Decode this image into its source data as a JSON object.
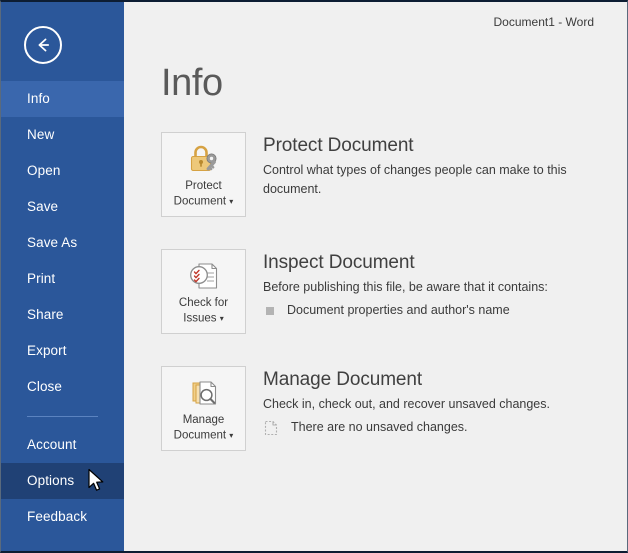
{
  "window": {
    "document_title": "Document1 - Word"
  },
  "sidebar": {
    "back_button": "back-arrow-icon",
    "items": [
      {
        "label": "Info",
        "state": "selected"
      },
      {
        "label": "New",
        "state": "normal"
      },
      {
        "label": "Open",
        "state": "normal"
      },
      {
        "label": "Save",
        "state": "normal"
      },
      {
        "label": "Save As",
        "state": "normal"
      },
      {
        "label": "Print",
        "state": "normal"
      },
      {
        "label": "Share",
        "state": "normal"
      },
      {
        "label": "Export",
        "state": "normal"
      },
      {
        "label": "Close",
        "state": "normal"
      }
    ],
    "items_bottom": [
      {
        "label": "Account",
        "state": "normal"
      },
      {
        "label": "Options",
        "state": "hovered"
      },
      {
        "label": "Feedback",
        "state": "normal"
      }
    ],
    "colors": {
      "background": "#2b579a",
      "selected": "#3a67ad",
      "hovered": "#204175",
      "separator": "#5b83c0",
      "text": "#ffffff"
    }
  },
  "main": {
    "page_heading": "Info",
    "sections": [
      {
        "button_label_line1": "Protect",
        "button_label_line2": "Document",
        "icon": "padlock-key-icon",
        "title": "Protect Document",
        "description": "Control what types of changes people can make to this document.",
        "bullets": []
      },
      {
        "button_label_line1": "Check for",
        "button_label_line2": "Issues",
        "icon": "document-inspect-icon",
        "title": "Inspect Document",
        "description": "Before publishing this file, be aware that it contains:",
        "bullets": [
          {
            "marker": "square-bullet",
            "text": "Document properties and author's name"
          }
        ]
      },
      {
        "button_label_line1": "Manage",
        "button_label_line2": "Document",
        "icon": "document-stack-search-icon",
        "title": "Manage Document",
        "description": "Check in, check out, and recover unsaved changes.",
        "bullets": [
          {
            "marker": "dashed-document-icon",
            "text": "There are no unsaved changes."
          }
        ]
      }
    ],
    "caret": "▾",
    "colors": {
      "background": "#f0f0f0",
      "button_face": "#f5f5f5",
      "button_border": "#d0d0d0",
      "title_text": "#404040",
      "body_text": "#3b3b3b",
      "heading_text": "#5a5a5a",
      "icon_gold": "#e8b23a",
      "icon_gray": "#808080",
      "icon_red": "#c0392b"
    }
  }
}
